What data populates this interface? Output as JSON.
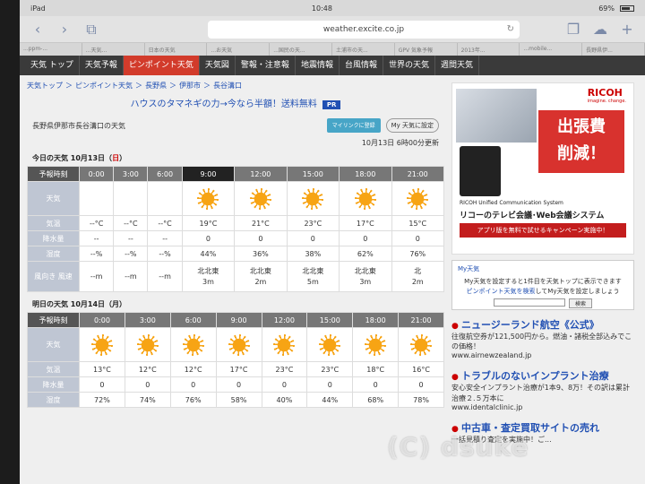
{
  "status": {
    "device": "iPad",
    "time": "10:48",
    "battery": "69%"
  },
  "browser": {
    "url": "weather.excite.co.jp"
  },
  "tabs": [
    "...ppm-...",
    "...天気...",
    "日本の天気",
    "...お天気",
    "...国民の天...",
    "土浦市の天...",
    "GPV 気象予報",
    "2013年...",
    "...mobile...",
    "長野県伊..."
  ],
  "nav": [
    {
      "label": "天気 トップ",
      "active": false
    },
    {
      "label": "天気予報",
      "active": false
    },
    {
      "label": "ピンポイント天気",
      "active": true
    },
    {
      "label": "天気図",
      "active": false
    },
    {
      "label": "警報・注意報",
      "active": false
    },
    {
      "label": "地震情報",
      "active": false
    },
    {
      "label": "台風情報",
      "active": false
    },
    {
      "label": "世界の天気",
      "active": false
    },
    {
      "label": "週間天気",
      "active": false
    }
  ],
  "breadcrumb": [
    "天気トップ",
    "＞",
    "ピンポイント天気",
    "＞",
    "長野県",
    "＞",
    "伊那市",
    "＞",
    "長谷溝口"
  ],
  "ad_text": "ハウスのタマネギの力→今なら半額！送料無料",
  "ad_badge": "PR",
  "location_title": "長野県伊那市長谷溝口の天気",
  "btn_mylink": "マイリンクに登録",
  "btn_mywx": "My 天気に設定",
  "updated": "10月13日 6時00分更新",
  "today": {
    "head": "今日の天気 10月13日（",
    "sun": "日",
    "close": "）",
    "label_time": "予報時刻",
    "times": [
      "0:00",
      "3:00",
      "6:00",
      "9:00",
      "12:00",
      "15:00",
      "18:00",
      "21:00"
    ],
    "label_weather": "天気",
    "weather": [
      "",
      "",
      "",
      "sun",
      "sun",
      "sun",
      "sun",
      "sun"
    ],
    "label_temp": "気温",
    "temps": [
      "--°C",
      "--°C",
      "--°C",
      "19°C",
      "21°C",
      "23°C",
      "17°C",
      "15°C"
    ],
    "label_rain": "降水量",
    "rain": [
      "--",
      "--",
      "--",
      "0",
      "0",
      "0",
      "0",
      "0"
    ],
    "label_hum": "湿度",
    "hum": [
      "--%",
      "--%",
      "--%",
      "44%",
      "36%",
      "38%",
      "62%",
      "76%"
    ],
    "label_wind": "風向き 風速",
    "wind_dir": [
      "",
      "",
      "",
      "北北東",
      "北北東",
      "北北東",
      "北北東",
      "北"
    ],
    "wind_spd": [
      "--m",
      "--m",
      "--m",
      "3m",
      "2m",
      "5m",
      "3m",
      "2m"
    ]
  },
  "tomorrow": {
    "head": "明日の天気 10月14日（月）",
    "label_time": "予報時刻",
    "times": [
      "0:00",
      "3:00",
      "6:00",
      "9:00",
      "12:00",
      "15:00",
      "18:00",
      "21:00"
    ],
    "label_weather": "天気",
    "label_temp": "気温",
    "temps": [
      "13°C",
      "12°C",
      "12°C",
      "17°C",
      "23°C",
      "23°C",
      "18°C",
      "16°C"
    ],
    "label_rain": "降水量",
    "rain": [
      "0",
      "0",
      "0",
      "0",
      "0",
      "0",
      "0",
      "0"
    ],
    "label_hum": "湿度",
    "hum": [
      "72%",
      "74%",
      "76%",
      "58%",
      "40%",
      "44%",
      "68%",
      "78%"
    ]
  },
  "ricoh": {
    "logo": "RICOH",
    "logo_sub": "imagine. change.",
    "banner_1": "出張費",
    "banner_2": "削減！",
    "system": "RICOH Unified Communication System",
    "tagline": "リコーのテレビ会議･Web会議システム",
    "cta": "アプリ版を無料で試せるキャンペーン実施中！"
  },
  "my_weather": {
    "title": "My天気",
    "line1": "My天気を設定すると1件目を天気トップに表示できます",
    "link": "ピンポイント天気を検索",
    "line2": "してMy天気を設定しましょう",
    "search_btn": "検索"
  },
  "side_ads": [
    {
      "title": "ニュージーランド航空《公式》",
      "body": "往復航空券が121,500円から。燃油・諸税全部込みでこの価格！",
      "url": "www.airnewzealand.jp"
    },
    {
      "title": "トラブルのないインプラント治療",
      "body": "安心安全インプラント治療が1本9、8万！その訳は累計治療２.５万本に",
      "url": "www.identalclinic.jp"
    },
    {
      "title": "中古車・査定買取サイトの売れ",
      "body": "一括見積り査定を実施中！ご..."
    }
  ],
  "watermark": "(C) dsuke"
}
